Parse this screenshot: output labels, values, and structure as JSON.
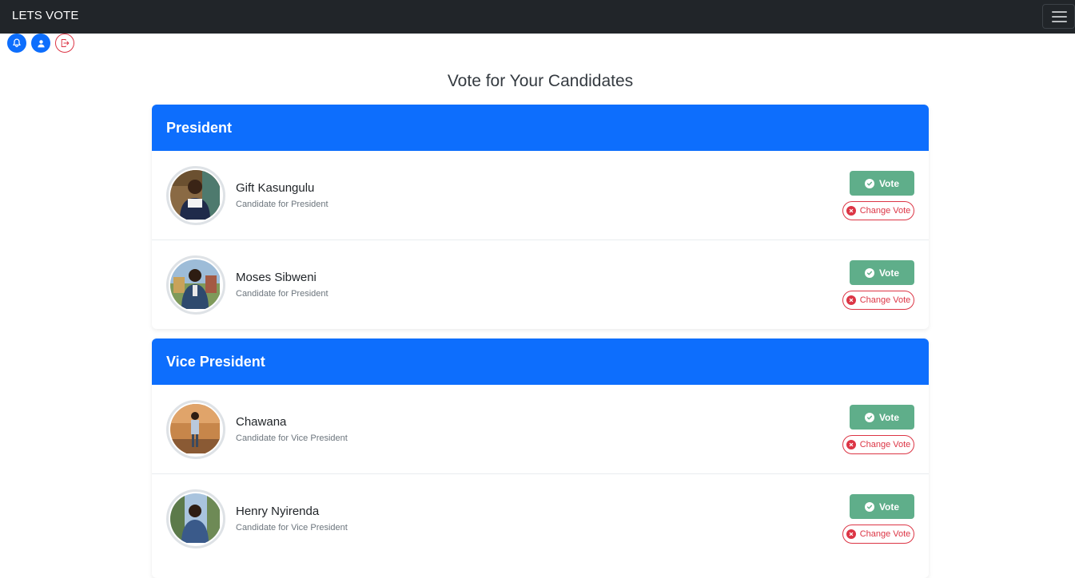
{
  "app": {
    "brand": "LETS VOTE"
  },
  "navbar": {
    "menu_icon": "hamburger-icon"
  },
  "toolbar": {
    "icons": [
      "bell-icon",
      "user-icon",
      "logout-icon"
    ]
  },
  "page": {
    "title": "Vote for Your Candidates"
  },
  "colors": {
    "primary": "#0d6efd",
    "success": "#5fae8a",
    "danger": "#dc3545",
    "navbar": "#212529"
  },
  "sections": [
    {
      "title": "President",
      "candidates": [
        {
          "name": "Gift Kasungulu",
          "role": "Candidate for President",
          "vote_label": "Vote",
          "change_label": "Change Vote"
        },
        {
          "name": "Moses Sibweni",
          "role": "Candidate for President",
          "vote_label": "Vote",
          "change_label": "Change Vote"
        }
      ]
    },
    {
      "title": "Vice President",
      "candidates": [
        {
          "name": "Chawana",
          "role": "Candidate for Vice President",
          "vote_label": "Vote",
          "change_label": "Change Vote"
        },
        {
          "name": "Henry Nyirenda",
          "role": "Candidate for Vice President",
          "vote_label": "Vote",
          "change_label": "Change Vote"
        }
      ]
    }
  ]
}
